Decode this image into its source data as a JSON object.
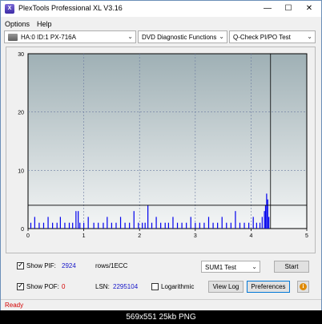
{
  "window": {
    "title": "PlexTools Professional XL V3.16",
    "icon_label": "X",
    "controls": {
      "minimize": "—",
      "maximize": "☐",
      "close": "✕"
    }
  },
  "menu": {
    "items": [
      "Options",
      "Help"
    ]
  },
  "toolbar": {
    "drive": "HA:0 ID:1  PX-716A",
    "function": "DVD Diagnostic Functions",
    "test": "Q-Check PI/PO Test",
    "dropdown_arrow": "⌄"
  },
  "chart_data": {
    "type": "bar",
    "xlim": [
      0,
      5
    ],
    "ylim": [
      0,
      30
    ],
    "x_ticks": [
      "0",
      "1",
      "2",
      "3",
      "4",
      "5"
    ],
    "y_ticks": [
      "0",
      "10",
      "20",
      "30"
    ],
    "threshold_line": 4,
    "end_marker_x": 4.35,
    "grid": true,
    "series": [
      {
        "color": "#0000ee",
        "x": [
          0.05,
          0.12,
          0.2,
          0.28,
          0.36,
          0.44,
          0.52,
          0.58,
          0.66,
          0.74,
          0.8,
          0.86,
          0.9,
          0.93,
          1.0,
          1.08,
          1.18,
          1.26,
          1.35,
          1.42,
          1.5,
          1.58,
          1.66,
          1.74,
          1.82,
          1.9,
          1.98,
          2.05,
          2.1,
          2.15,
          2.22,
          2.3,
          2.38,
          2.46,
          2.52,
          2.6,
          2.68,
          2.76,
          2.84,
          2.92,
          3.0,
          3.08,
          3.16,
          3.24,
          3.32,
          3.4,
          3.48,
          3.56,
          3.64,
          3.72,
          3.8,
          3.88,
          3.96,
          4.04,
          4.1,
          4.16,
          4.2,
          4.24,
          4.26,
          4.28,
          4.3,
          4.32
        ],
        "values": [
          1,
          2,
          1,
          1,
          2,
          1,
          1,
          2,
          1,
          1,
          1,
          3,
          3,
          1,
          1,
          2,
          1,
          1,
          1,
          2,
          1,
          1,
          2,
          1,
          1,
          3,
          1,
          1,
          1,
          4,
          1,
          2,
          1,
          1,
          1,
          2,
          1,
          1,
          1,
          2,
          1,
          1,
          1,
          2,
          1,
          1,
          2,
          1,
          1,
          3,
          1,
          1,
          1,
          2,
          1,
          1,
          2,
          3,
          4,
          6,
          5,
          2
        ]
      }
    ]
  },
  "controls": {
    "show_pif_label": "Show PIF:",
    "pif_value": "2924",
    "pif_unit": "rows/1ECC",
    "show_pof_label": "Show POF:",
    "pof_value": "0",
    "lsn_label": "LSN:",
    "lsn_value": "2295104",
    "logarithmic_label": "Logarithmic",
    "sum_select": "SUM1 Test",
    "start_button": "Start",
    "view_log_button": "View Log",
    "preferences_button": "Preferences",
    "info_icon": "i",
    "pif_checked": true,
    "pof_checked": true,
    "log_checked": false
  },
  "status": {
    "text": "Ready"
  },
  "caption": {
    "text": "569x551  25kb  PNG"
  }
}
